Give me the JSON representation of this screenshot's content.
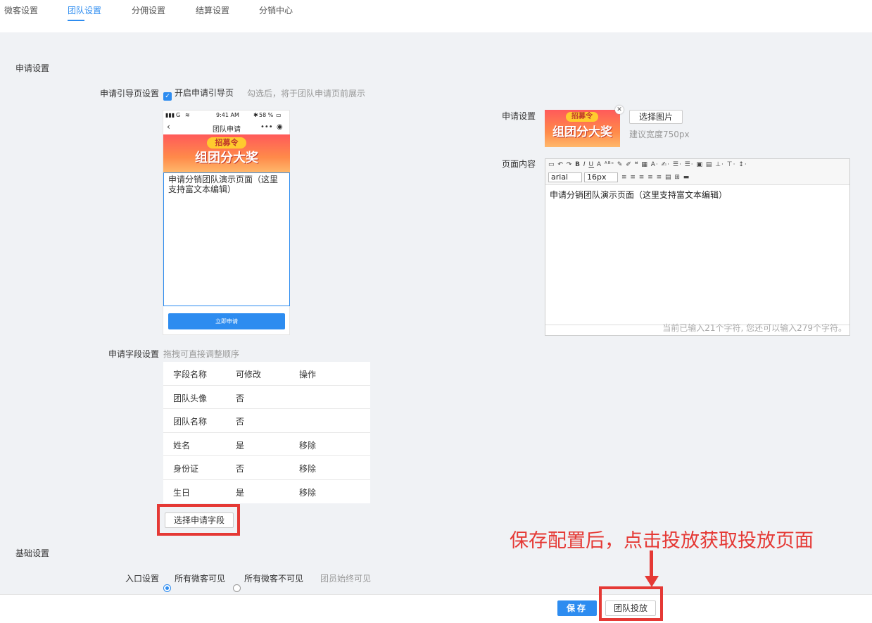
{
  "tabs": [
    {
      "label": "微客设置"
    },
    {
      "label": "团队设置"
    },
    {
      "label": "分佣设置"
    },
    {
      "label": "结算设置"
    },
    {
      "label": "分销中心"
    }
  ],
  "apply": {
    "section_title": "申请设置",
    "guide_label": "申请引导页设置",
    "guide_checkbox_label": "开启申请引导页",
    "guide_checked": true,
    "guide_hint": "勾选后，将于团队申请页前展示"
  },
  "phone": {
    "status_signal": "G",
    "status_time": "9:41 AM",
    "status_battery": "58 %",
    "nav_title": "团队申请",
    "nav_more": "•••",
    "banner_pill": "招募令",
    "banner_big": "组团分大奖",
    "content_text": "申请分销团队演示页面（这里支持富文本编辑）",
    "button_label": "立即申请"
  },
  "right": {
    "image_label": "申请设置",
    "choose_image_button": "选择图片",
    "image_hint": "建议宽度750px",
    "content_label": "页面内容",
    "editor": {
      "font_family": "arial",
      "font_size": "16px",
      "content": "申请分销团队演示页面（这里支持富文本编辑）",
      "counter": "当前已输入21个字符, 您还可以输入279个字符。"
    }
  },
  "fields": {
    "label": "申请字段设置",
    "hint": "拖拽可直接调整顺序",
    "headers": [
      "字段名称",
      "可修改",
      "操作"
    ],
    "rows": [
      {
        "name": "团队头像",
        "editable": "否",
        "action": ""
      },
      {
        "name": "团队名称",
        "editable": "否",
        "action": ""
      },
      {
        "name": "姓名",
        "editable": "是",
        "action": "移除"
      },
      {
        "name": "身份证",
        "editable": "否",
        "action": "移除"
      },
      {
        "name": "生日",
        "editable": "是",
        "action": "移除"
      }
    ],
    "select_button": "选择申请字段"
  },
  "basic": {
    "section_title": "基础设置",
    "entry_label": "入口设置",
    "options": [
      {
        "label": "所有微客可见",
        "selected": true
      },
      {
        "label": "所有微客不可见",
        "selected": false
      },
      {
        "label": "团员始终可见",
        "selected": false
      }
    ]
  },
  "annotation": "保存配置后，点击投放获取投放页面",
  "footer": {
    "save_button": "保存",
    "deploy_button": "团队投放"
  },
  "colors": {
    "accent": "#2d8cf0",
    "highlight": "#e53935"
  }
}
